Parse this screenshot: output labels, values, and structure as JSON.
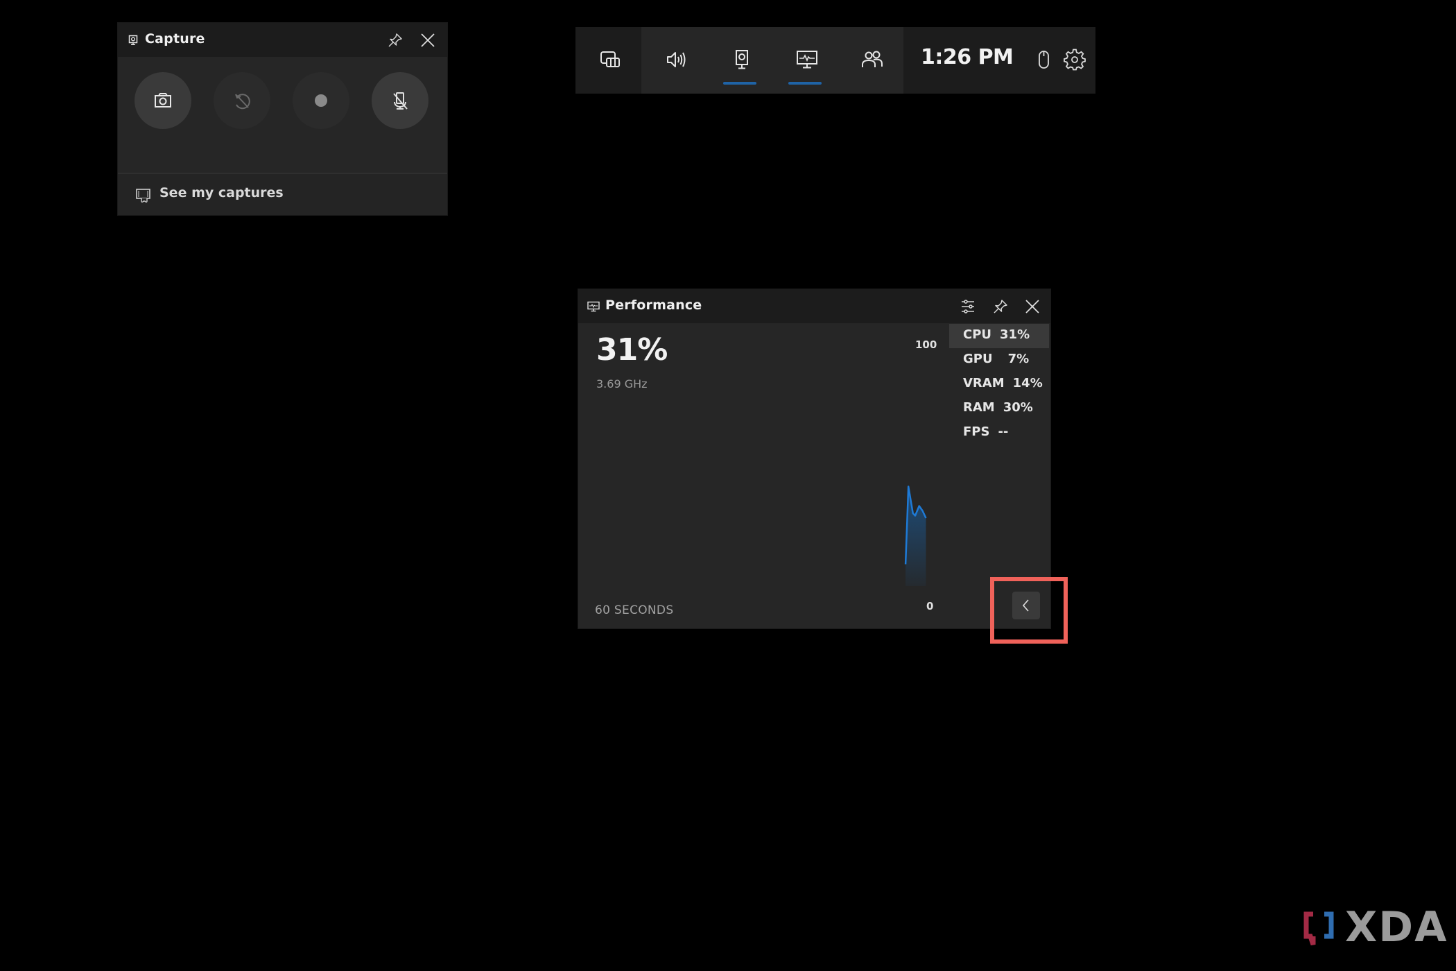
{
  "capture_widget": {
    "title": "Capture",
    "buttons": [
      {
        "name": "screenshot",
        "icon": "camera-icon"
      },
      {
        "name": "record-last-30s",
        "icon": "record-last-disabled-icon"
      },
      {
        "name": "start-recording",
        "icon": "record-dot-icon"
      },
      {
        "name": "mic-toggle",
        "icon": "mic-off-icon"
      }
    ],
    "footer_label": "See my captures"
  },
  "toolbar": {
    "items": [
      {
        "name": "widget-menu",
        "icon": "widget-menu-icon",
        "active": false
      },
      {
        "name": "audio",
        "icon": "speaker-icon",
        "active": false
      },
      {
        "name": "capture",
        "icon": "capture-icon",
        "active": true
      },
      {
        "name": "performance",
        "icon": "performance-monitor-icon",
        "active": true
      },
      {
        "name": "social",
        "icon": "people-icon",
        "active": false
      }
    ],
    "clock": "1:26 PM",
    "right_icons": [
      "mouse-icon",
      "gear-icon"
    ],
    "accent_color": "#1f63a6"
  },
  "performance_widget": {
    "title": "Performance",
    "big_value": "31%",
    "sub_value": "3.69 GHz",
    "axis_max_label": "100",
    "axis_min_label": "0",
    "window_label": "60 SECONDS",
    "metrics": [
      {
        "name": "CPU",
        "value": "31%",
        "selected": true
      },
      {
        "name": "GPU",
        "value": "7%",
        "selected": false
      },
      {
        "name": "VRAM",
        "value": "14%",
        "selected": false
      },
      {
        "name": "RAM",
        "value": "30%",
        "selected": false
      },
      {
        "name": "FPS",
        "value": "--",
        "selected": false
      }
    ],
    "graph": {
      "metric": "CPU",
      "unit": "%",
      "y_range": [
        0,
        100
      ],
      "window_seconds": 60,
      "series_seconds_ago": [
        5,
        4.5,
        3.7,
        3.3,
        2.6,
        2.0,
        1.4
      ],
      "series_values": [
        9,
        41,
        30,
        29,
        33,
        31,
        28
      ],
      "line_color": "#1e7ad6"
    },
    "collapse_button_icon": "chevron-left-icon"
  },
  "annotation": {
    "highlight_color": "#f0625a",
    "target": "collapse-button"
  },
  "watermark": {
    "brand": "XDA"
  }
}
